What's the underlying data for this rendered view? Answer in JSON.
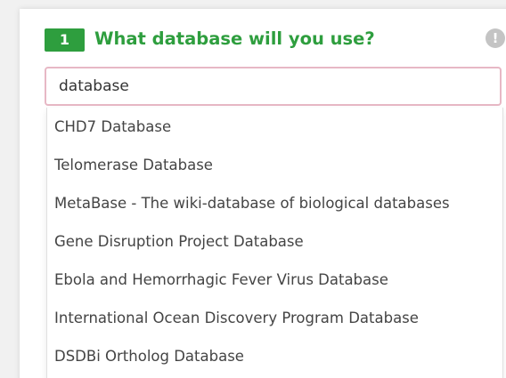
{
  "step": {
    "number": "1",
    "question": "What database will you use?"
  },
  "info": {
    "icon": "info-icon",
    "glyph": "!"
  },
  "search": {
    "value": "database",
    "placeholder": ""
  },
  "suggestions": [
    {
      "label": "CHD7 Database"
    },
    {
      "label": "Telomerase Database"
    },
    {
      "label": "MetaBase - The wiki-database of biological databases"
    },
    {
      "label": "Gene Disruption Project Database"
    },
    {
      "label": "Ebola and Hemorrhagic Fever Virus Database"
    },
    {
      "label": "International Ocean Discovery Program Database"
    },
    {
      "label": "DSDBi Ortholog Database"
    }
  ],
  "colors": {
    "accent": "#2e9e3e",
    "input_border": "#e7b8c5",
    "info_icon": "#c4c4c4"
  }
}
